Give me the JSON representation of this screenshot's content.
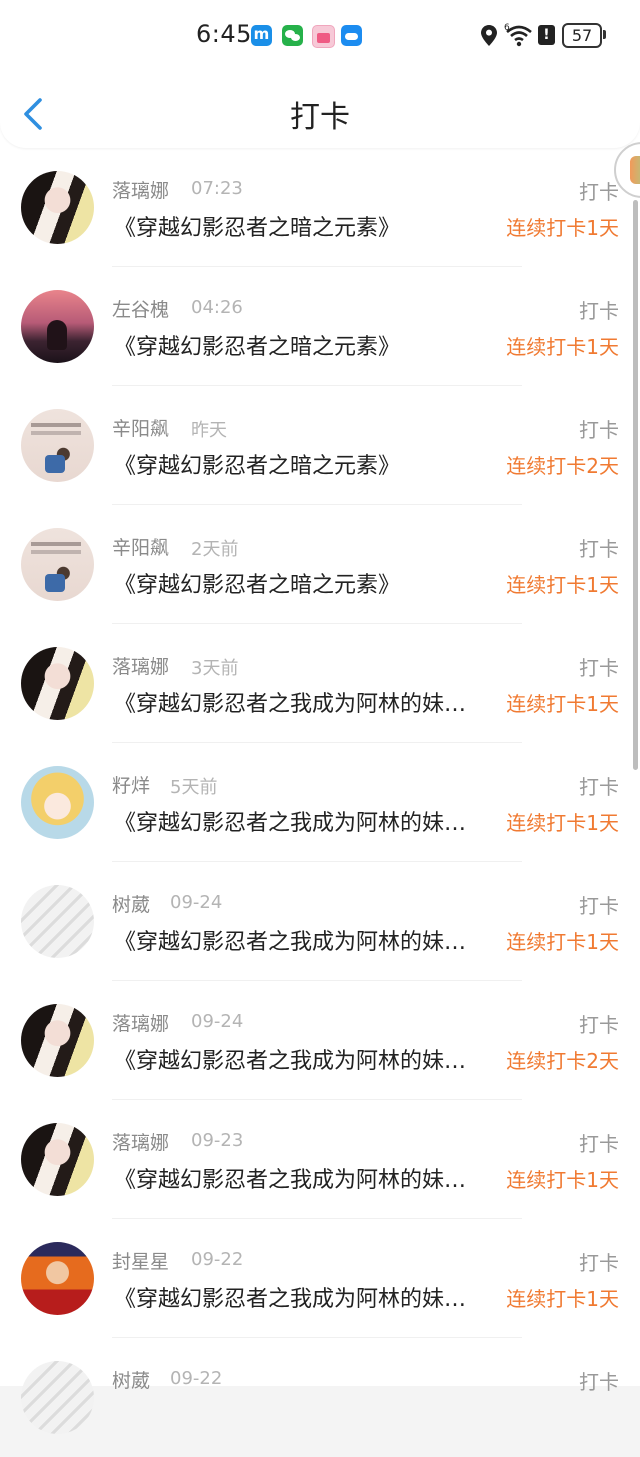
{
  "status_bar": {
    "time": "6:45",
    "app_icons": [
      "m-app-icon",
      "wechat-icon",
      "gift-app-icon",
      "cloud-app-icon"
    ],
    "battery": "57",
    "signal": "6"
  },
  "nav": {
    "title": "打卡",
    "back_icon": "chevron-left-icon"
  },
  "colors": {
    "accent_blue": "#2f8fe0",
    "streak_orange": "#f07a32",
    "name_gray": "#8a8a8a",
    "time_gray": "#b4b4b4"
  },
  "items": [
    {
      "name": "落璃娜",
      "time": "07:23",
      "book": "《穿越幻影忍者之暗之元素》",
      "tag": "打卡",
      "streak": "连续打卡1天"
    },
    {
      "name": "左谷槐",
      "time": "04:26",
      "book": "《穿越幻影忍者之暗之元素》",
      "tag": "打卡",
      "streak": "连续打卡1天"
    },
    {
      "name": "辛阳飙",
      "time": "昨天",
      "book": "《穿越幻影忍者之暗之元素》",
      "tag": "打卡",
      "streak": "连续打卡2天"
    },
    {
      "name": "辛阳飙",
      "time": "2天前",
      "book": "《穿越幻影忍者之暗之元素》",
      "tag": "打卡",
      "streak": "连续打卡1天"
    },
    {
      "name": "落璃娜",
      "time": "3天前",
      "book": "《穿越幻影忍者之我成为阿林的妹…",
      "tag": "打卡",
      "streak": "连续打卡1天"
    },
    {
      "name": "籽烊",
      "time": "5天前",
      "book": "《穿越幻影忍者之我成为阿林的妹…",
      "tag": "打卡",
      "streak": "连续打卡1天"
    },
    {
      "name": "树葳",
      "time": "09-24",
      "book": "《穿越幻影忍者之我成为阿林的妹…",
      "tag": "打卡",
      "streak": "连续打卡1天"
    },
    {
      "name": "落璃娜",
      "time": "09-24",
      "book": "《穿越幻影忍者之我成为阿林的妹…",
      "tag": "打卡",
      "streak": "连续打卡2天"
    },
    {
      "name": "落璃娜",
      "time": "09-23",
      "book": "《穿越幻影忍者之我成为阿林的妹…",
      "tag": "打卡",
      "streak": "连续打卡1天"
    },
    {
      "name": "封星星",
      "time": "09-22",
      "book": "《穿越幻影忍者之我成为阿林的妹…",
      "tag": "打卡",
      "streak": "连续打卡1天"
    },
    {
      "name": "树葳",
      "time": "09-22",
      "book": "",
      "tag": "打卡",
      "streak": ""
    }
  ]
}
